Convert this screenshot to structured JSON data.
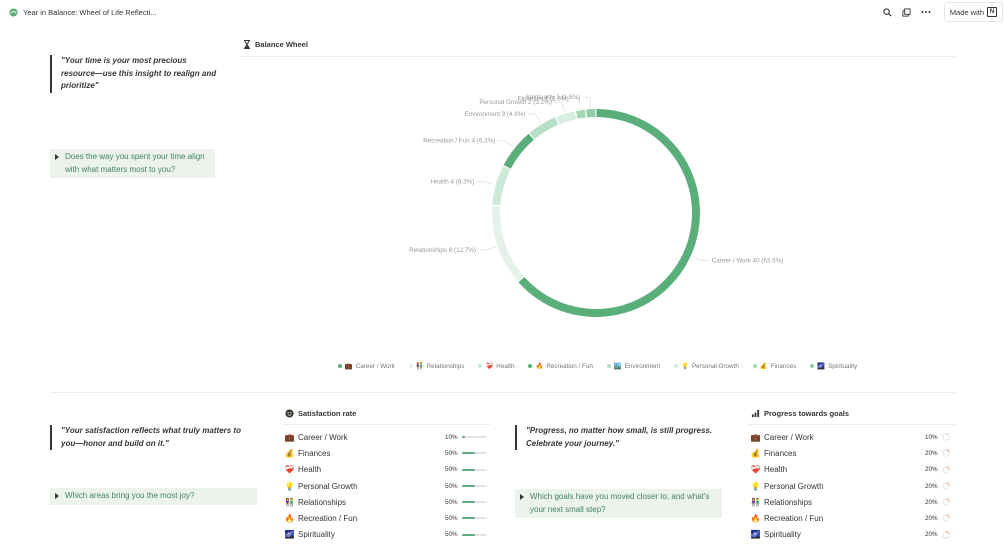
{
  "topbar": {
    "title": "Year in Balance: Wheel of Life Reflecti...",
    "icons": [
      "search-icon",
      "duplicate-icon",
      "more-icon"
    ],
    "made_with": "Made with"
  },
  "top_section": {
    "quote": "\"Your time is your most precious resource—use this insight to realign and prioritize\"",
    "toggle": "Does the way you spent your time align with what matters most to you?"
  },
  "balance_wheel": {
    "title": "Balance Wheel",
    "icon": "hourglass-icon"
  },
  "chart_data": {
    "type": "pie",
    "style": "donut",
    "title": "",
    "categories": [
      "Career / Work",
      "Relationships",
      "Health",
      "Recreation / Fun",
      "Environment",
      "Personal Growth",
      "Finances",
      "Spirituality"
    ],
    "values": [
      40,
      8,
      4,
      4,
      3,
      2,
      1,
      1
    ],
    "labels": [
      "Career / Work  40 (63.5%)",
      "Relationships  8 (12.7%)",
      "Health  4 (6.3%)",
      "Recreation / Fun  4 (6.3%)",
      "Environment  3 (4.8%)",
      "Personal Growth  2 (3.2%)",
      "Finances  1 (1.6%)",
      "Spirituality  1 (1.6%)"
    ],
    "colors": [
      "#5aae7a",
      "#e4f3ea",
      "#cde9d8",
      "#5aae7a",
      "#b7dfc6",
      "#d6eedf",
      "#a6d7b8",
      "#8fcba4"
    ],
    "legend_position": "bottom"
  },
  "legend": [
    {
      "emoji": "💼",
      "label": "Career / Work",
      "color": "#5aae7a"
    },
    {
      "emoji": "👫",
      "label": "Relationships",
      "color": "#e4f3ea"
    },
    {
      "emoji": "❤️‍🩹",
      "label": "Health",
      "color": "#cde9d8"
    },
    {
      "emoji": "🔥",
      "label": "Recreation / Fun",
      "color": "#5aae7a"
    },
    {
      "emoji": "🏙️",
      "label": "Environment",
      "color": "#b7dfc6"
    },
    {
      "emoji": "💡",
      "label": "Personal Growth",
      "color": "#d6eedf"
    },
    {
      "emoji": "💰",
      "label": "Finances",
      "color": "#a6d7b8"
    },
    {
      "emoji": "🌌",
      "label": "Spirituality",
      "color": "#8fcba4"
    }
  ],
  "satisfaction_section": {
    "quote": "\"Your satisfaction reflects what truly matters to you—honor and build on it.\"",
    "toggle": "Which areas bring you the most joy?"
  },
  "satisfaction": {
    "title": "Satisfaction rate",
    "icon": "smiley-icon",
    "rows": [
      {
        "emoji": "💼",
        "label": "Career / Work",
        "pct": "10%",
        "value": 0.1
      },
      {
        "emoji": "💰",
        "label": "Finances",
        "pct": "50%",
        "value": 0.5
      },
      {
        "emoji": "❤️‍🩹",
        "label": "Health",
        "pct": "50%",
        "value": 0.5
      },
      {
        "emoji": "💡",
        "label": "Personal Growth",
        "pct": "50%",
        "value": 0.5
      },
      {
        "emoji": "👫",
        "label": "Relationships",
        "pct": "50%",
        "value": 0.5
      },
      {
        "emoji": "🔥",
        "label": "Recreation / Fun",
        "pct": "50%",
        "value": 0.5
      },
      {
        "emoji": "🌌",
        "label": "Spirituality",
        "pct": "50%",
        "value": 0.5
      }
    ]
  },
  "progress_section": {
    "quote": "\"Progress, no matter how small, is still progress. Celebrate your journey.\"",
    "toggle": "Which goals have you moved closer to, and what's your next small step?"
  },
  "progress": {
    "title": "Progress towards goals",
    "icon": "bar-chart-icon",
    "rows": [
      {
        "emoji": "💼",
        "label": "Career / Work",
        "pct": "10%",
        "value": 0.1
      },
      {
        "emoji": "💰",
        "label": "Finances",
        "pct": "20%",
        "value": 0.2
      },
      {
        "emoji": "❤️‍🩹",
        "label": "Health",
        "pct": "20%",
        "value": 0.2
      },
      {
        "emoji": "💡",
        "label": "Personal Growth",
        "pct": "20%",
        "value": 0.2
      },
      {
        "emoji": "👫",
        "label": "Relationships",
        "pct": "20%",
        "value": 0.2
      },
      {
        "emoji": "🔥",
        "label": "Recreation / Fun",
        "pct": "20%",
        "value": 0.2
      },
      {
        "emoji": "🌌",
        "label": "Spirituality",
        "pct": "20%",
        "value": 0.2
      }
    ]
  },
  "colors": {
    "accent": "#448361",
    "toggle_bg": "#ebf3ec",
    "bar_fill": "#5aae7a"
  }
}
